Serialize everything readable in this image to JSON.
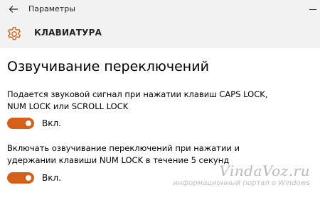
{
  "window": {
    "title": "Параметры",
    "back_icon": "back-arrow-icon",
    "minimize_icon": "minimize-icon"
  },
  "header": {
    "icon": "gear-icon",
    "title": "КЛАВИАТУРА"
  },
  "page": {
    "title": "Озвучивание переключений"
  },
  "settings": [
    {
      "description_lines": [
        "Подается звуковой сигнал при нажатии клавиш CAPS LOCK,",
        "NUM LOCK или SCROLL LOCK"
      ],
      "toggle_state": "Вкл.",
      "on": true
    },
    {
      "description_lines": [
        "Включать озвучивание переключений при нажатии и",
        "удержании клавиши NUM LOCK в течение 5 секунд"
      ],
      "toggle_state": "Вкл.",
      "on": true
    }
  ],
  "watermark": {
    "brand": "VindaVoz.ru",
    "subtitle": "информационный портал о Windows"
  },
  "colors": {
    "accent": "#d4601a",
    "chrome": "#f2f2f2",
    "watermark": "#b9b9b9"
  }
}
